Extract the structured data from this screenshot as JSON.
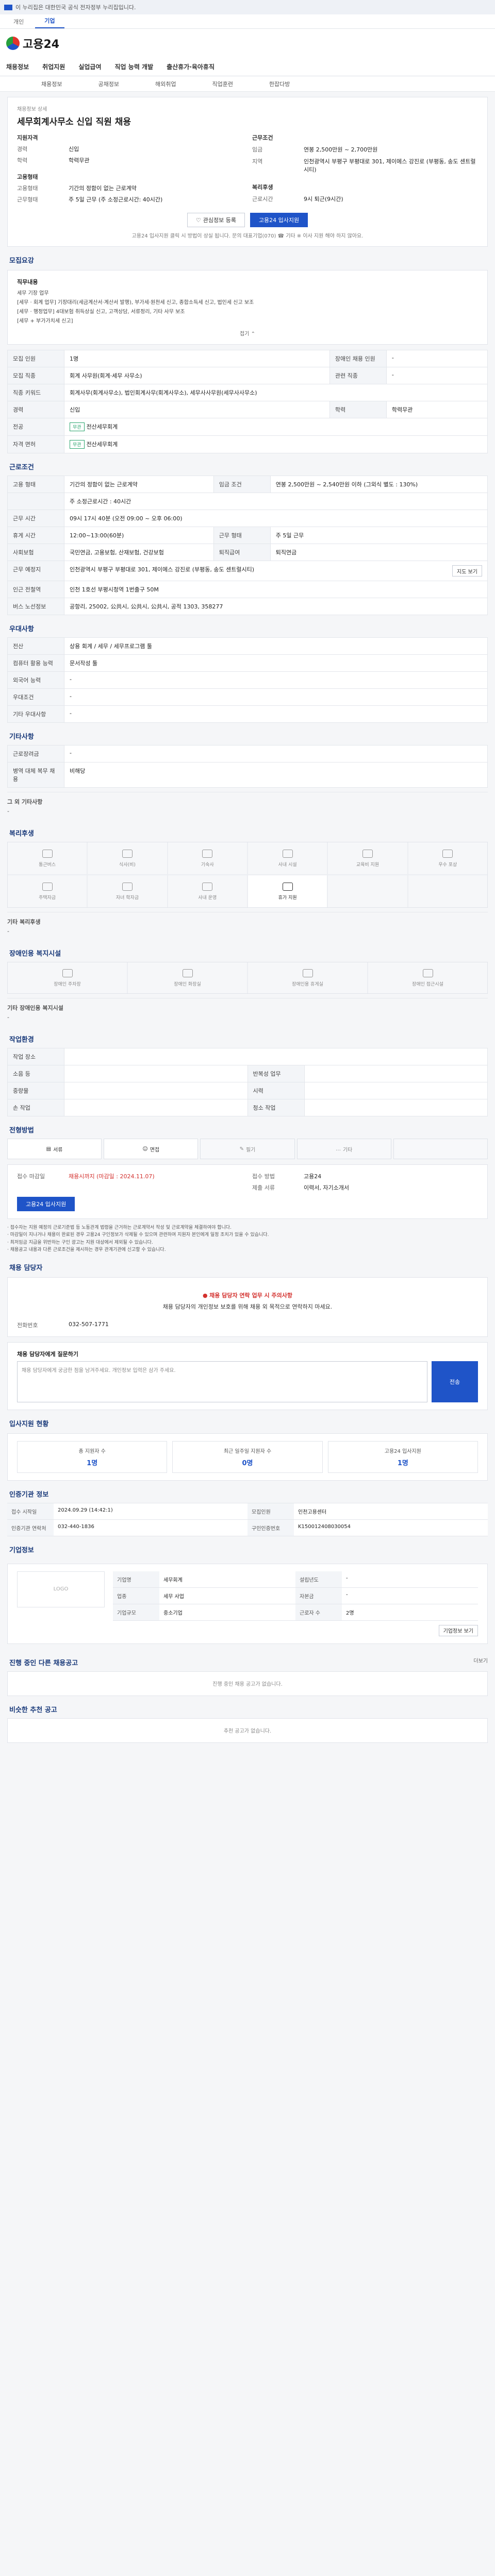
{
  "top": {
    "notice": "이 누리집은 대한민국 공식 전자정부 누리집입니다."
  },
  "tabs": [
    "개인",
    "기업"
  ],
  "brand": {
    "logo_text": "고용24"
  },
  "gnb": [
    "채용정보",
    "취업지원",
    "실업급여",
    "직업 능력 개발",
    "출산휴가·육아휴직"
  ],
  "subnav": [
    "채용정보",
    "공채정보",
    "해외취업",
    "직업훈련",
    "한잡다방"
  ],
  "job": {
    "breadcrumb": "채용정보 상세",
    "title": "세무회계사무소 신입 직원 채용",
    "summary_left": [
      {
        "k": "지원자격",
        "v": ""
      },
      {
        "k": "경력",
        "v": "신입"
      },
      {
        "k": "학력",
        "v": "학력무관"
      },
      {
        "k": "고용형태",
        "v": ""
      },
      {
        "k": "고용형태",
        "v": "기간의 정함이 없는 근로계약"
      },
      {
        "k": "근무형태",
        "v": "주 5일 근무 (주 소정근로시간: 40시간)"
      }
    ],
    "summary_right": [
      {
        "k": "근무조건",
        "v": ""
      },
      {
        "k": "임금",
        "v": "연봉 2,500만원 ~ 2,700만원"
      },
      {
        "k": "지역",
        "v": "인천광역시 부평구 부평대로 301, 제이에스 강진로 (부평동, 송도 센트럴시티)"
      },
      {
        "k": "복리후생",
        "v": ""
      },
      {
        "k": "근로시간",
        "v": "9시 퇴근(9시간)"
      }
    ],
    "btn_scrap": "관심정보 등록",
    "btn_apply": "고용24 입사지원",
    "apply_note": "고용24 입사지원 클릭 시 방법이 상실 됩니다. 문의 대표기업(070) ☎ 기타 ※ 이사 지원 해야 하지 않아요."
  },
  "recruit": {
    "head": "모집요강",
    "duties_label": "직무내용",
    "duties": "세무 기장 업무\n[세무 · 회계 업무] 기장대리(세금계산서·계산서 발행), 부가세·원천세 신고, 종합소득세 신고, 법인세 신고 보조\n[세무 · 행정업무] 4대보험 취득상실 신고, 고객상담, 서류정리, 기타 사무 보조\n[세무 + 부가가치세 신고]",
    "fold": "접기",
    "rows": [
      {
        "k": "모집 인원",
        "v": "1명",
        "k2": "장애인 채용 인원",
        "v2": "-"
      },
      {
        "k": "모집 직종",
        "v": "회계 사무원(회계·세무 사무소)",
        "k2": "관련 직종",
        "v2": "-"
      },
      {
        "k": "직종 키워드",
        "v": "회계사무(회계사무소), 법인회계사무(회계사무소), 세무사사무원(세무사사무소)",
        "k2": "",
        "v2": ""
      },
      {
        "k": "경력",
        "v": "신입",
        "k2": "학력",
        "v2": "학력무관"
      },
      {
        "k": "전공",
        "v": "",
        "k2": "",
        "v2": ""
      },
      {
        "k": "자격 면허",
        "v": "",
        "k2": "",
        "v2": ""
      }
    ],
    "tag_majors": [
      "무관",
      "무관"
    ],
    "major_text": [
      "전산세무회계",
      "전산세무회계"
    ]
  },
  "work": {
    "head": "근로조건",
    "rows": [
      {
        "k": "고용 형태",
        "v": "기간의 정함이 없는 근로계약",
        "k2": "임금 조건",
        "v2": "연봉 2,500만원 ~ 2,540만원 이하 (그외식 별도 : 130%)"
      },
      {
        "k": "",
        "v": "주 소정근로시간 : 40시간",
        "k2": "",
        "v2": ""
      },
      {
        "k": "근무 시간",
        "v": "09시 17시 40분 (오전 09:00 ~ 오후 06:00)",
        "k2": "",
        "v2": ""
      },
      {
        "k": "휴게 시간",
        "v": "12:00~13:00(60분)",
        "k2": "근무 형태",
        "v2": "주 5일 근무"
      },
      {
        "k": "사회보험",
        "v": "국민연금, 고용보험, 산재보험, 건강보험",
        "k2": "퇴직급여",
        "v2": "퇴직연금"
      },
      {
        "k": "근무 예정지",
        "v": "인천광역시 부평구 부평대로 301, 제이에스 강진로 (부평동, 송도 센트럴시티)",
        "k2": "",
        "v2": ""
      },
      {
        "k": "인근 전철역",
        "v": "인천 1호선 부평시청역 1번출구 50M",
        "k2": "",
        "v2": ""
      },
      {
        "k": "버스 노선정보",
        "v": "공항리, 25002, 公共시, 公共시, 公共시, 공적 1303, 358277",
        "k2": "",
        "v2": ""
      }
    ],
    "map_btn": "지도 보기"
  },
  "prefer": {
    "head": "우대사항",
    "rows": [
      {
        "k": "전산",
        "v": "상용 회계 / 세무 / 세무프로그램 툴"
      },
      {
        "k": "컴퓨터 활용 능력",
        "v": "문서작성 툴"
      },
      {
        "k": "외국어 능력",
        "v": "-"
      },
      {
        "k": "우대조건",
        "v": "-"
      },
      {
        "k": "기타 우대사항",
        "v": "-"
      }
    ]
  },
  "etc": {
    "head": "기타사항",
    "rows": [
      {
        "k": "근로장려금",
        "v": "-"
      },
      {
        "k": "병역 대체 복무 채용",
        "v": "비해당"
      }
    ],
    "sub": "그 외 기타사항",
    "sub_v": "-"
  },
  "welfare": {
    "head": "복리후생",
    "items": [
      "통근버스",
      "식사(비)",
      "기숙사",
      "사내 시설",
      "교육비 지원",
      "우수 포상",
      "주택자금",
      "자녀 학자금",
      "사내 운영",
      "휴가 지원"
    ],
    "on_index": 9,
    "sub": "기타 복리후생",
    "sub_v": "-"
  },
  "disab": {
    "head": "장애인용 복지시설",
    "items": [
      "장애인 주차장",
      "장애인 화장실",
      "장애인용 휴게실",
      "장애인 접근시설"
    ],
    "sub": "기타 장애인용 복지시설",
    "sub_v": "-"
  },
  "env": {
    "head": "작업환경",
    "rows": [
      {
        "k": "작업 장소",
        "v": "",
        "k2": "",
        "v2": ""
      },
      {
        "k": "소음 등",
        "v": "",
        "k2": "반복성 업무",
        "v2": ""
      },
      {
        "k": "중량물",
        "v": "",
        "k2": "시력",
        "v2": ""
      },
      {
        "k": "손 작업",
        "v": "",
        "k2": "청소 작업",
        "v2": ""
      }
    ]
  },
  "process": {
    "head": "전형방법",
    "steps": [
      "서류",
      "면접",
      "필기",
      "기타"
    ],
    "deadline_k": "접수 마감일",
    "deadline_v": "채용시까지 (마감일 : 2024.11.07)",
    "method_k": "접수 방법",
    "method_v": "고용24",
    "docs_k": "제출 서류",
    "docs_v": "이력서, 자기소개서",
    "apply_btn": "고용24 입사지원",
    "notes": [
      "· 접수자는 지원 예정의 근로기준법 등 노동관계 법령을 근거하는 근로계약서 작성 및 근로계약을 체결하여야 합니다.",
      "· 마감일이 지나거나 채용이 완료된 경우 고용24 구인정보가 삭제될 수 있으며 관련하여 지원자 본인에게 일정 조치가 있을 수 있습니다.",
      "· 최저임금 지급을 위반하는 구인 광고는 지원 대상에서 제외될 수 있습니다.",
      "· 채용공고 내용과 다른 근로조건을 제시하는 경우 관계기관에 신고할 수 있습니다."
    ]
  },
  "contact": {
    "head": "채용 담당자",
    "alert_red": "채용 담당자 연락 업무 시 주의사항",
    "alert_text": "채용 담당자의 개인정보 보호를 위해 채용 외 목적으로 연락하지 마세요.",
    "phone_k": "전화번호",
    "phone_v": "032-507-1771",
    "qa_head": "채용 담당자에게 질문하기",
    "qa_placeholder": "채용 담당자에게 궁금한 점을 남겨주세요. 개인정보 입력은 삼가 주세요.",
    "qa_btn": "전송"
  },
  "stats": {
    "head": "입사지원 현황",
    "items": [
      {
        "k": "총 지원자 수",
        "v": "1명"
      },
      {
        "k": "최근 일주일 지원자 수",
        "v": "0명"
      },
      {
        "k": "고용24 입사지원",
        "v": "1명"
      }
    ]
  },
  "info": {
    "head": "인증기관 정보",
    "rows": [
      {
        "k": "접수 시작일",
        "v": "2024.09.29 (14:42:1)",
        "k2": "모집인원",
        "v2": "인천고용센터"
      },
      {
        "k": "인증기관 연락처",
        "v": "032-440-1836",
        "k2": "구인인증번호",
        "v2": "K150012408030054"
      }
    ]
  },
  "company": {
    "head": "기업정보",
    "logo": "LOGO",
    "rows": [
      {
        "k": "기업명",
        "v": "세무회계",
        "k2": "설립년도",
        "v2": "-"
      },
      {
        "k": "업종",
        "v": "세무 사업",
        "k2": "자본금",
        "v2": "-"
      },
      {
        "k": "기업규모",
        "v": "중소기업",
        "k2": "근로자 수",
        "v2": "2명"
      }
    ],
    "btn": "기업정보 보기"
  },
  "similar": {
    "head": "진행 중인 다른 채용공고",
    "more": "더보기",
    "empty": "진행 중인 채용 공고가 없습니다."
  },
  "recommend": {
    "head": "비슷한 추천 공고",
    "empty": "추천 공고가 없습니다."
  }
}
